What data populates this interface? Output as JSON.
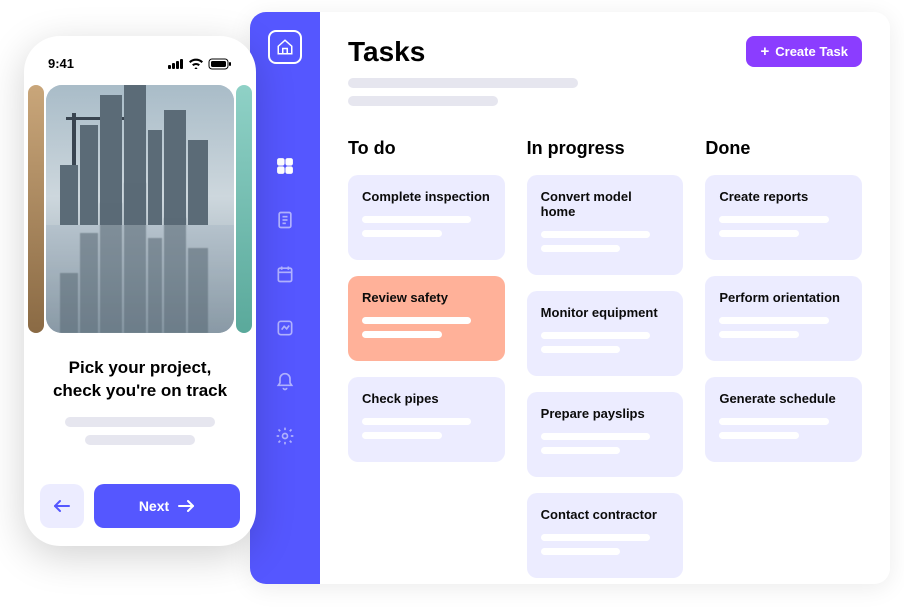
{
  "phone": {
    "time": "9:41",
    "title_line1": "Pick your project,",
    "title_line2": "check you're on track",
    "back_icon": "arrow-left",
    "next_label": "Next",
    "image_alt": "city skyline with crane"
  },
  "sidebar": {
    "logo_icon": "house-plan",
    "items": [
      {
        "icon": "dashboard-icon",
        "active": true
      },
      {
        "icon": "document-icon",
        "active": false
      },
      {
        "icon": "calendar-icon",
        "active": false
      },
      {
        "icon": "chart-icon",
        "active": false
      },
      {
        "icon": "bell-icon",
        "active": false
      },
      {
        "icon": "gear-icon",
        "active": false
      }
    ]
  },
  "header": {
    "title": "Tasks",
    "create_label": "Create Task"
  },
  "board": {
    "columns": [
      {
        "title": "To do",
        "cards": [
          {
            "title": "Complete inspection",
            "highlight": false
          },
          {
            "title": "Review safety",
            "highlight": true
          },
          {
            "title": "Check pipes",
            "highlight": false
          }
        ]
      },
      {
        "title": "In progress",
        "cards": [
          {
            "title": "Convert model home",
            "highlight": false
          },
          {
            "title": "Monitor equipment",
            "highlight": false
          },
          {
            "title": "Prepare payslips",
            "highlight": false
          },
          {
            "title": "Contact contractor",
            "highlight": false
          }
        ]
      },
      {
        "title": "Done",
        "cards": [
          {
            "title": "Create reports",
            "highlight": false
          },
          {
            "title": "Perform orientation",
            "highlight": false
          },
          {
            "title": "Generate schedule",
            "highlight": false
          }
        ]
      }
    ]
  }
}
